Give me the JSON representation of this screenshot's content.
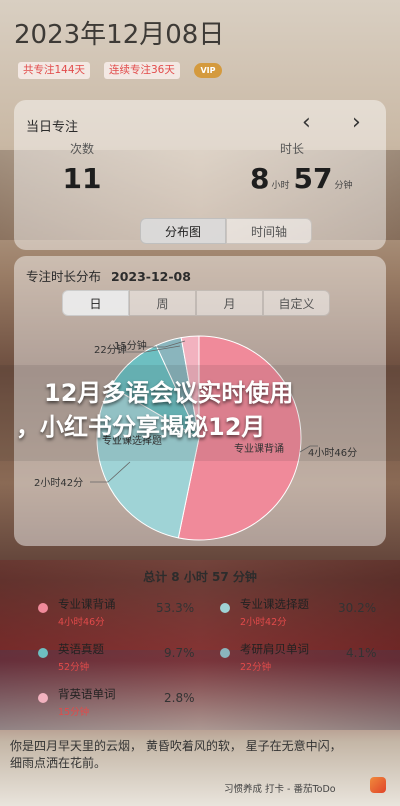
{
  "date_title": "2023年12月08日",
  "badges": {
    "total": "共专注144天",
    "streak": "连续专注36天",
    "vip": "VIP"
  },
  "focus_card": {
    "title": "当日专注",
    "prev_icon": "chevron-left-icon",
    "next_icon": "chevron-right-icon",
    "count_label": "次数",
    "count_value": "11",
    "duration_label": "时长",
    "duration_hours": "8",
    "duration_hours_unit": "小时",
    "duration_minutes": "57",
    "duration_minutes_unit": "分钟",
    "view_toggle": [
      "分布图",
      "时间轴"
    ],
    "view_toggle_active": 0
  },
  "distribution": {
    "title": "专注时长分布",
    "date": "2023-12-08",
    "tabs": [
      "日",
      "周",
      "月",
      "自定义"
    ],
    "active_tab": 0,
    "pie_labels": {
      "l1": "15分钟",
      "l2": "22分钟",
      "l3": "专业课选择题",
      "l4": "2小时42分",
      "l5": "专业课背诵",
      "l6": "4小时46分"
    }
  },
  "banner": {
    "line1": "12月多语会议实时使用",
    "line2": "，小红书分享揭秘12月"
  },
  "total_text": "总计 8 小时 57 分钟",
  "chart_data": {
    "type": "pie",
    "categories": [
      "专业课背诵",
      "专业课选择题",
      "英语真题",
      "考研肩贝单词",
      "背英语单词"
    ],
    "values": [
      53.3,
      30.2,
      9.7,
      4.1,
      2.8
    ],
    "durations": [
      "4小时46分",
      "2小时42分",
      "52分钟",
      "22分钟",
      "15分钟"
    ],
    "colors": [
      "#f08a9a",
      "#9fd3d6",
      "#6dbfc1",
      "#8ab5bd",
      "#f2b2bf"
    ]
  },
  "legend": [
    {
      "name": "专业课背诵",
      "duration": "4小时46分",
      "percent": "53.3%",
      "color": "#f08a9a"
    },
    {
      "name": "专业课选择题",
      "duration": "2小时42分",
      "percent": "30.2%",
      "color": "#9fd3d6"
    },
    {
      "name": "英语真题",
      "duration": "52分钟",
      "percent": "9.7%",
      "color": "#6dbfc1"
    },
    {
      "name": "考研肩贝单词",
      "duration": "22分钟",
      "percent": "4.1%",
      "color": "#8ab5bd"
    },
    {
      "name": "背英语单词",
      "duration": "15分钟",
      "percent": "2.8%",
      "color": "#f2b2bf"
    }
  ],
  "poem": {
    "line1": "你是四月早天里的云烟， 黄昏吹着风的软， 星子在无意中闪，",
    "line2": "细雨点洒在花前。"
  },
  "footer": {
    "app_name": "习惯养成 打卡 - 番茄ToDo"
  }
}
